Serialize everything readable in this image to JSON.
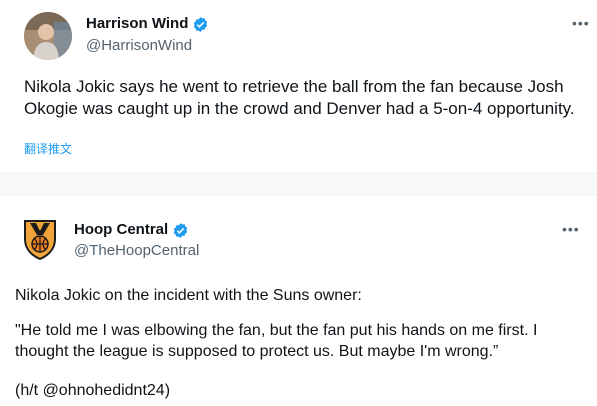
{
  "tweet1": {
    "name": "Harrison Wind",
    "handle": "@HarrisonWind",
    "more": "•••",
    "text": "Nikola Jokic says he went to retrieve the ball from the fan because Josh Okogie was caught up in the crowd and Denver had a 5-on-4 opportunity.",
    "translate": "翻译推文"
  },
  "tweet2": {
    "name": "Hoop Central",
    "handle": "@TheHoopCentral",
    "more": "•••",
    "line1": "Nikola Jokic on the incident with the Suns owner:",
    "quote": "\"He told me I was elbowing the fan, but the fan put his hands on me first. I thought the league is supposed to protect us. But maybe I'm wrong.”",
    "credit": "(h/t @ohnohedidnt24)"
  },
  "colors": {
    "verified": "#1d9bf0",
    "secondary": "#536471",
    "link": "#1d9bf0"
  },
  "icons": [
    "verified-badge-icon",
    "more-options-icon",
    "avatar",
    "hoop-central-logo"
  ]
}
